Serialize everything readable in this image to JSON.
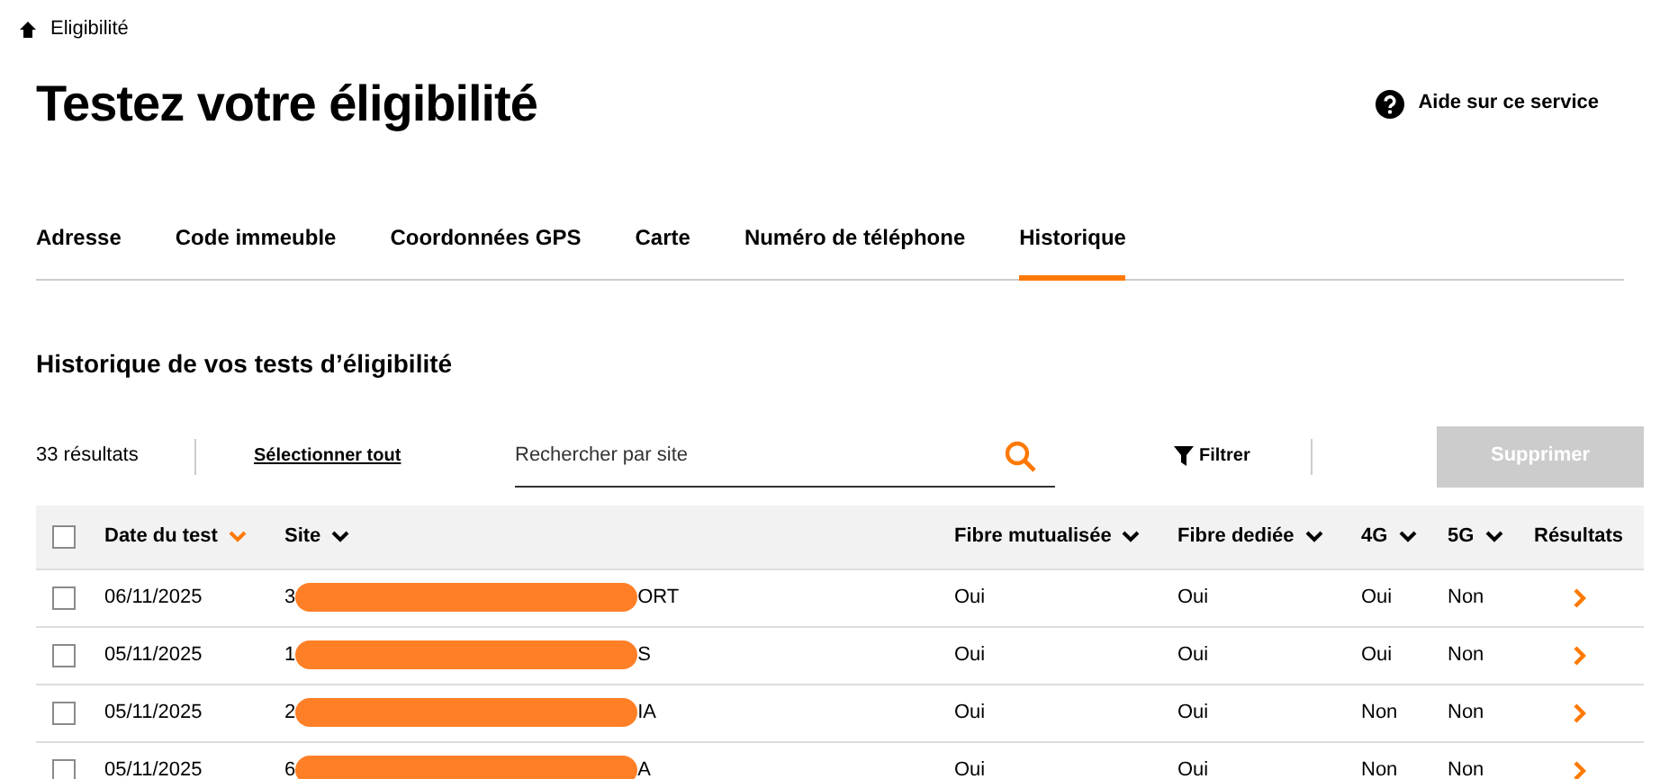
{
  "breadcrumb": "Eligibilité",
  "title": "Testez votre éligibilité",
  "help_link": "Aide sur ce service",
  "tabs": [
    {
      "label": "Adresse",
      "selected": false
    },
    {
      "label": "Code immeuble",
      "selected": false
    },
    {
      "label": "Coordonnées GPS",
      "selected": false
    },
    {
      "label": "Carte",
      "selected": false
    },
    {
      "label": "Numéro de téléphone",
      "selected": false
    },
    {
      "label": "Historique",
      "selected": true
    }
  ],
  "section_title": "Historique de vos tests d’éligibilité",
  "toolbar": {
    "count": "33 résultats",
    "select_all": "Sélectionner tout",
    "search": {
      "placeholder": "Rechercher par site"
    },
    "filter": "Filtrer",
    "delete": {
      "label": "Supprimer",
      "disabled": true
    }
  },
  "table": {
    "header_checked": false,
    "columns": [
      {
        "label": "Date du test",
        "sortable": true,
        "sorted": true
      },
      {
        "label": "Site",
        "sortable": true,
        "sorted": false
      },
      {
        "label": "Fibre mutualisée",
        "sortable": true,
        "sorted": false
      },
      {
        "label": "Fibre dediée",
        "sortable": true,
        "sorted": false
      },
      {
        "label": "4G",
        "sortable": true,
        "sorted": false
      },
      {
        "label": "5G",
        "sortable": true,
        "sorted": false
      },
      {
        "label": "Résultats",
        "sortable": false
      }
    ],
    "rows": [
      {
        "checked": false,
        "date": "06/11/2025",
        "site_start": "3",
        "site_end": "ORT",
        "fibre_mutualisee": "Oui",
        "fibre_dediee": "Oui",
        "4g": "Oui",
        "5g": "Non"
      },
      {
        "checked": false,
        "date": "05/11/2025",
        "site_start": "1",
        "site_end": "S",
        "fibre_mutualisee": "Oui",
        "fibre_dediee": "Oui",
        "4g": "Oui",
        "5g": "Non"
      },
      {
        "checked": false,
        "date": "05/11/2025",
        "site_start": "2",
        "site_end": "IA",
        "fibre_mutualisee": "Oui",
        "fibre_dediee": "Oui",
        "4g": "Non",
        "5g": "Non"
      },
      {
        "checked": false,
        "date": "05/11/2025",
        "site_start": "6",
        "site_end": "A",
        "fibre_mutualisee": "Oui",
        "fibre_dediee": "Oui",
        "4g": "Non",
        "5g": "Non"
      }
    ]
  }
}
